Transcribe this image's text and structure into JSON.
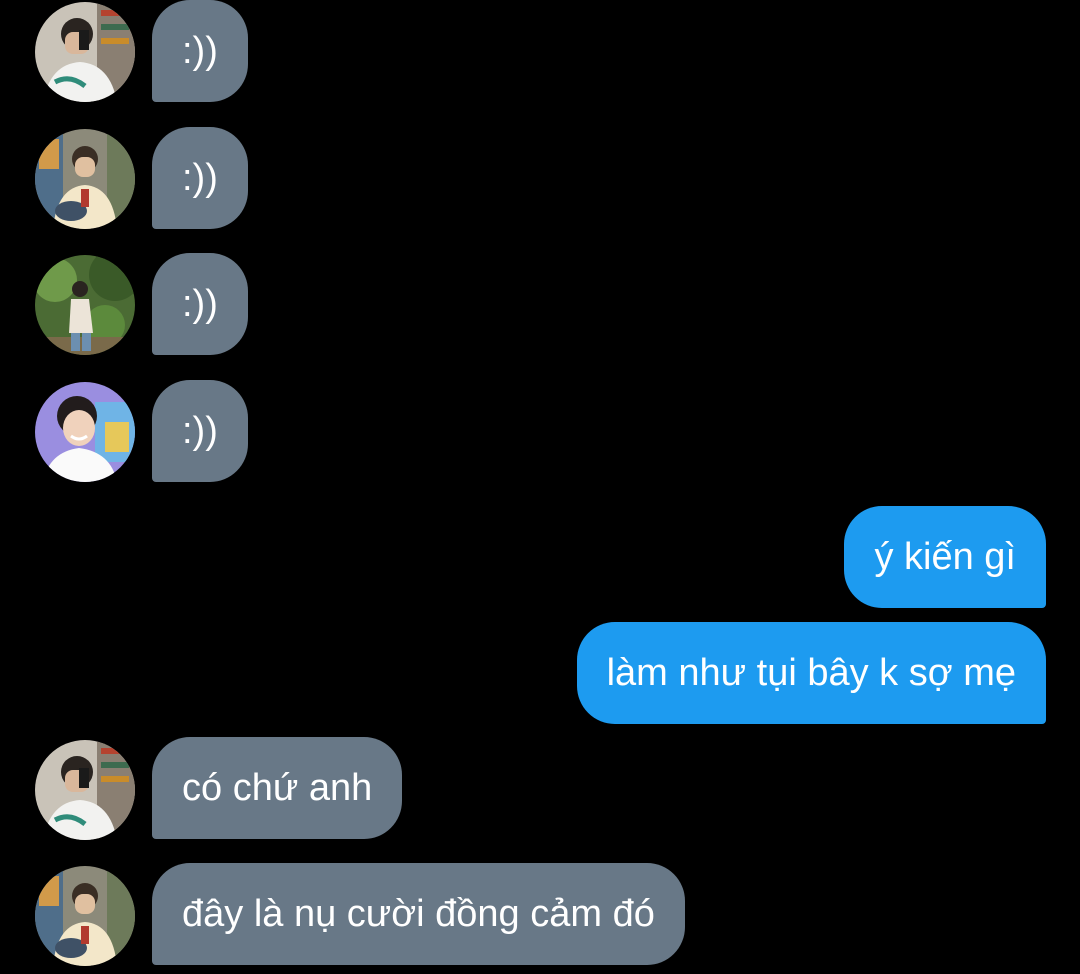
{
  "messages": [
    {
      "side": "in",
      "avatar": "user-a",
      "text": ":))"
    },
    {
      "side": "in",
      "avatar": "user-b",
      "text": ":))"
    },
    {
      "side": "in",
      "avatar": "user-c",
      "text": ":))"
    },
    {
      "side": "in",
      "avatar": "user-d",
      "text": ":))"
    },
    {
      "side": "out",
      "text": "ý kiến gì"
    },
    {
      "side": "out",
      "text": "làm như tụi bây k sợ mẹ"
    },
    {
      "side": "in",
      "avatar": "user-a",
      "text": "có chứ anh"
    },
    {
      "side": "in",
      "avatar": "user-b",
      "text": "đây là nụ cười đồng cảm đó"
    }
  ],
  "colors": {
    "background": "#000000",
    "incoming_bubble": "#687887",
    "outgoing_bubble": "#1d9bf0",
    "text": "#ffffff"
  }
}
